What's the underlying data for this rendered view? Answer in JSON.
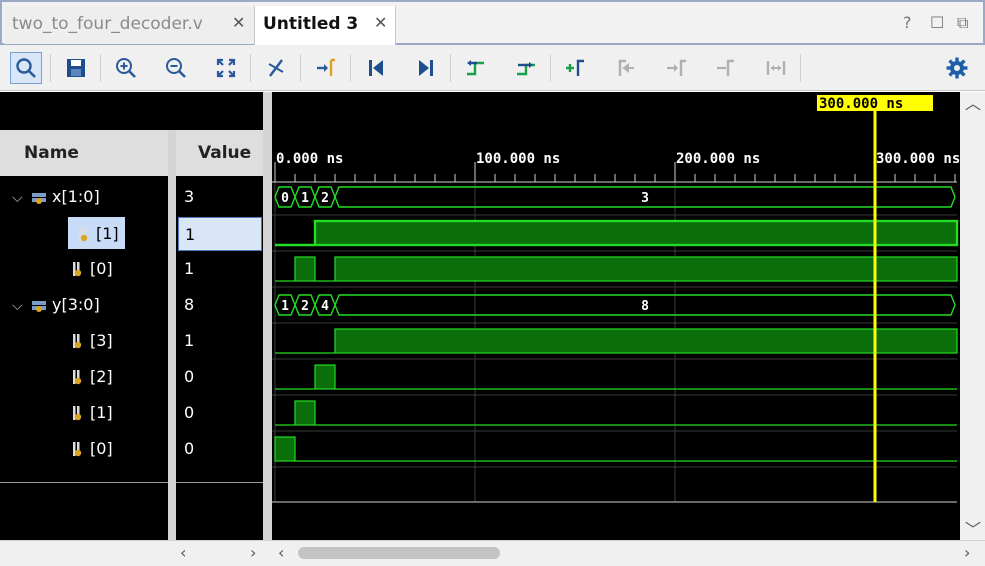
{
  "tabs": [
    {
      "label": "two_to_four_decoder.v",
      "active": false
    },
    {
      "label": "Untitled 3",
      "active": true
    }
  ],
  "window_buttons": {
    "help": "?",
    "restore": "☐",
    "float": "⧉"
  },
  "toolbar": {
    "icons": [
      "search-icon",
      "save-icon",
      "zoom-in-icon",
      "zoom-out-icon",
      "zoom-fit-icon",
      "cursor-to-zero-icon",
      "marker-icon",
      "go-to-start-icon",
      "go-to-end-icon",
      "previous-transition-icon",
      "next-transition-icon",
      "add-marker-icon",
      "previous-marker-icon",
      "next-marker-icon",
      "swap-cursor-icon",
      "distance-icon",
      "settings-icon"
    ]
  },
  "columns": {
    "name": "Name",
    "value": "Value"
  },
  "signals": [
    {
      "name": "x[1:0]",
      "value": "3",
      "type": "bus",
      "expanded": true
    },
    {
      "name": "[1]",
      "value": "1",
      "type": "bit",
      "selected": true
    },
    {
      "name": "[0]",
      "value": "1",
      "type": "bit"
    },
    {
      "name": "y[3:0]",
      "value": "8",
      "type": "bus",
      "expanded": true
    },
    {
      "name": "[3]",
      "value": "1",
      "type": "bit"
    },
    {
      "name": "[2]",
      "value": "0",
      "type": "bit"
    },
    {
      "name": "[1]",
      "value": "0",
      "type": "bit"
    },
    {
      "name": "[0]",
      "value": "0",
      "type": "bit"
    }
  ],
  "timeline": {
    "unit": "ns",
    "ticks": [
      "0.000 ns",
      "100.000 ns",
      "200.000 ns",
      "300.000 ns"
    ],
    "cursor_label": "300.000 ns",
    "cursor_time_ns": 300,
    "start_ns": 0,
    "ns_per_major": 100
  },
  "waves": {
    "x_bus": [
      {
        "t0": 0,
        "t1": 10,
        "v": "0"
      },
      {
        "t0": 10,
        "t1": 20,
        "v": "1"
      },
      {
        "t0": 20,
        "t1": 30,
        "v": "2"
      },
      {
        "t0": 30,
        "t1": 340,
        "v": "3"
      }
    ],
    "x1": [
      [
        0,
        0
      ],
      [
        20,
        1
      ]
    ],
    "x0": [
      [
        0,
        0
      ],
      [
        10,
        1
      ],
      [
        20,
        0
      ],
      [
        30,
        1
      ]
    ],
    "y_bus": [
      {
        "t0": 0,
        "t1": 10,
        "v": "1"
      },
      {
        "t0": 10,
        "t1": 20,
        "v": "2"
      },
      {
        "t0": 20,
        "t1": 30,
        "v": "4"
      },
      {
        "t0": 30,
        "t1": 340,
        "v": "8"
      }
    ],
    "y3": [
      [
        0,
        0
      ],
      [
        30,
        1
      ]
    ],
    "y2": [
      [
        0,
        0
      ],
      [
        20,
        1
      ],
      [
        30,
        0
      ]
    ],
    "y1": [
      [
        0,
        0
      ],
      [
        10,
        1
      ],
      [
        20,
        0
      ]
    ],
    "y0": [
      [
        0,
        1
      ],
      [
        10,
        0
      ]
    ]
  },
  "colors": {
    "wave_line": "#22dd22",
    "wave_fill": "#0a6e0a",
    "cursor": "#ffff00",
    "selected_row": "#c8dcf8",
    "grid": "#3b3b3b"
  }
}
